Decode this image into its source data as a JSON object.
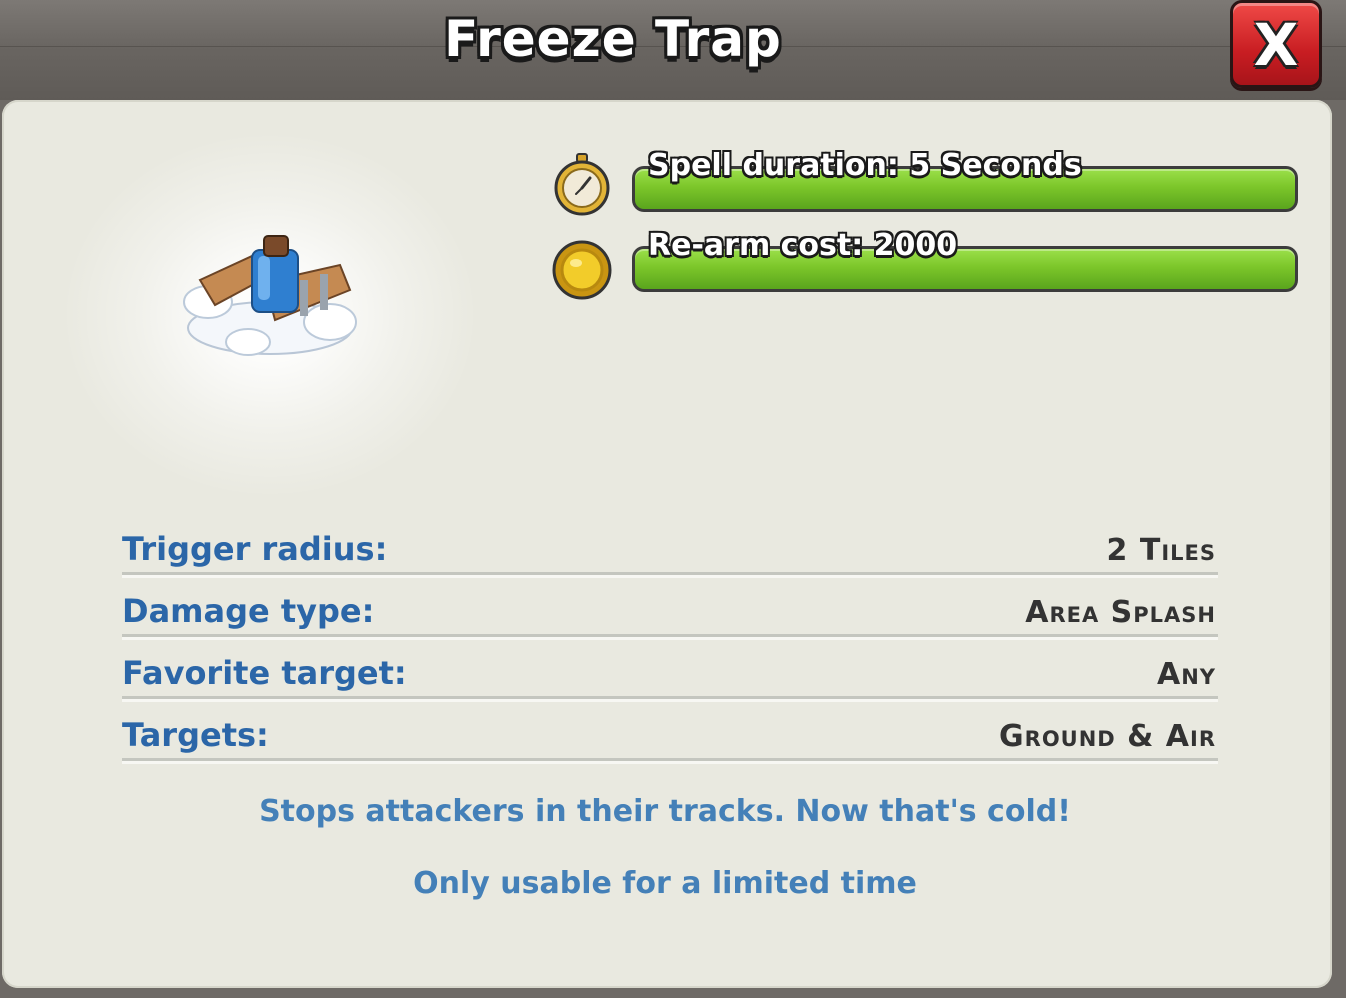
{
  "header": {
    "title": "Freeze Trap",
    "close_label": "X"
  },
  "stats": [
    {
      "icon": "stopwatch-icon",
      "label": "Spell duration: 5 Seconds",
      "fill": 1.0
    },
    {
      "icon": "gold-coin-icon",
      "label": "Re-arm cost: 2000",
      "fill": 1.0
    }
  ],
  "details": [
    {
      "label": "Trigger radius:",
      "value": "2 Tiles"
    },
    {
      "label": "Damage type:",
      "value": "Area Splash"
    },
    {
      "label": "Favorite target:",
      "value": "Any"
    },
    {
      "label": "Targets:",
      "value": "Ground & Air"
    }
  ],
  "description": "Stops attackers in their tracks. Now that's cold!",
  "availability_note": "Only usable for a limited time",
  "colors": {
    "bar_green": "#7cc62a",
    "label_blue": "#2b66a8",
    "close_red": "#c81d22",
    "panel_bg": "#e9e9e0"
  }
}
